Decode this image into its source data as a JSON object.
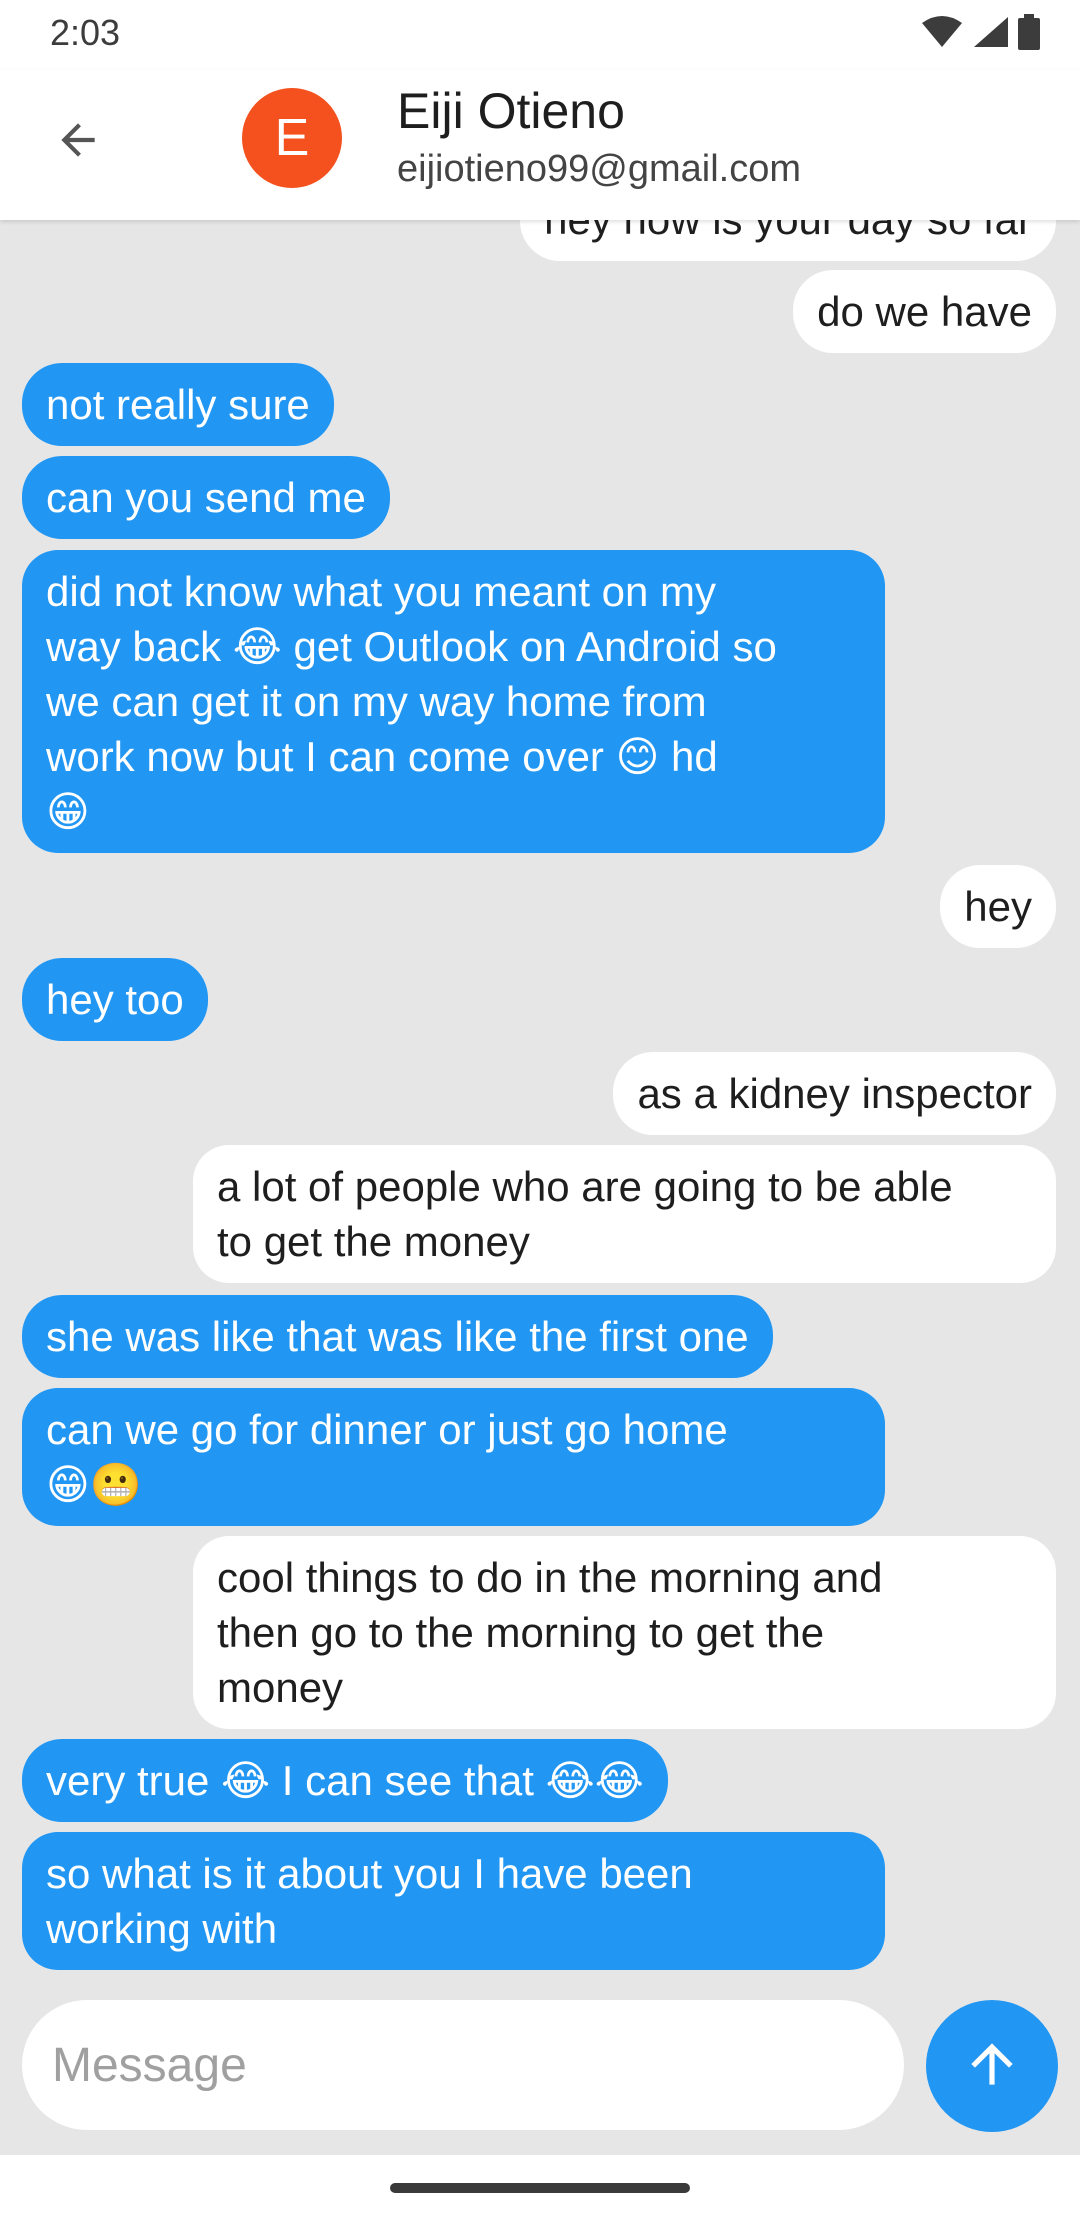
{
  "status_bar": {
    "time": "2:03"
  },
  "header": {
    "avatar_letter": "E",
    "name": "Eiji Otieno",
    "email": "eijiotieno99@gmail.com"
  },
  "messages": [
    {
      "side": "out",
      "text": "hey how is your day so far"
    },
    {
      "side": "out",
      "text": "do we have"
    },
    {
      "side": "in",
      "text": "not really sure"
    },
    {
      "side": "in",
      "text": "can you send me"
    },
    {
      "side": "in",
      "text": "did not know what you meant on my\nway back 😂 get Outlook on Android so\nwe can get it on my way home from\nwork now but I can come over 😊 hd\n😁"
    },
    {
      "side": "out",
      "text": "hey"
    },
    {
      "side": "in",
      "text": "hey too"
    },
    {
      "side": "out",
      "text": "as a kidney inspector"
    },
    {
      "side": "out",
      "text": "a lot of people who are going to be able\nto get the money"
    },
    {
      "side": "in",
      "text": "she was like that was like the first one"
    },
    {
      "side": "in",
      "text": "can we go for dinner or just go home\n😁😬"
    },
    {
      "side": "out",
      "text": "cool things to do in the morning and\nthen go to the morning to get the\nmoney"
    },
    {
      "side": "in",
      "text": "very true 😂 I can see that 😂😂"
    },
    {
      "side": "in",
      "text": "so what is it about you I have been\nworking with"
    }
  ],
  "composer": {
    "placeholder": "Message"
  },
  "colors": {
    "accent": "#2196f3",
    "avatar": "#f4511e",
    "background": "#e6e6e6"
  }
}
